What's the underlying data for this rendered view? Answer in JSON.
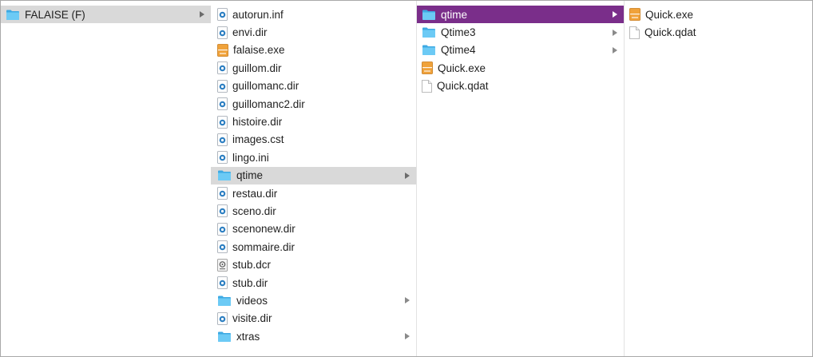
{
  "columns": [
    {
      "items": [
        {
          "label": "FALAISE (F)",
          "icon": "folder-icon",
          "chevron": true,
          "state": "gray"
        }
      ]
    },
    {
      "items": [
        {
          "label": "autorun.inf",
          "icon": "shockwave-file-icon",
          "chevron": false,
          "state": "none"
        },
        {
          "label": "envi.dir",
          "icon": "shockwave-file-icon",
          "chevron": false,
          "state": "none"
        },
        {
          "label": "falaise.exe",
          "icon": "exe-icon",
          "chevron": false,
          "state": "none"
        },
        {
          "label": "guillom.dir",
          "icon": "shockwave-file-icon",
          "chevron": false,
          "state": "none"
        },
        {
          "label": "guillomanc.dir",
          "icon": "shockwave-file-icon",
          "chevron": false,
          "state": "none"
        },
        {
          "label": "guillomanc2.dir",
          "icon": "shockwave-file-icon",
          "chevron": false,
          "state": "none"
        },
        {
          "label": "histoire.dir",
          "icon": "shockwave-file-icon",
          "chevron": false,
          "state": "none"
        },
        {
          "label": "images.cst",
          "icon": "shockwave-file-icon",
          "chevron": false,
          "state": "none"
        },
        {
          "label": "lingo.ini",
          "icon": "shockwave-file-icon",
          "chevron": false,
          "state": "none"
        },
        {
          "label": "qtime",
          "icon": "folder-icon",
          "chevron": true,
          "state": "gray"
        },
        {
          "label": "restau.dir",
          "icon": "shockwave-file-icon",
          "chevron": false,
          "state": "none"
        },
        {
          "label": "sceno.dir",
          "icon": "shockwave-file-icon",
          "chevron": false,
          "state": "none"
        },
        {
          "label": "scenonew.dir",
          "icon": "shockwave-file-icon",
          "chevron": false,
          "state": "none"
        },
        {
          "label": "sommaire.dir",
          "icon": "shockwave-file-icon",
          "chevron": false,
          "state": "none"
        },
        {
          "label": "stub.dcr",
          "icon": "dcr-file-icon",
          "chevron": false,
          "state": "none"
        },
        {
          "label": "stub.dir",
          "icon": "shockwave-file-icon",
          "chevron": false,
          "state": "none"
        },
        {
          "label": "videos",
          "icon": "folder-icon",
          "chevron": true,
          "state": "none"
        },
        {
          "label": "visite.dir",
          "icon": "shockwave-file-icon",
          "chevron": false,
          "state": "none"
        },
        {
          "label": "xtras",
          "icon": "folder-icon",
          "chevron": true,
          "state": "none"
        }
      ]
    },
    {
      "items": [
        {
          "label": "qtime",
          "icon": "folder-icon",
          "chevron": true,
          "state": "active"
        },
        {
          "label": "Qtime3",
          "icon": "folder-icon",
          "chevron": true,
          "state": "none"
        },
        {
          "label": "Qtime4",
          "icon": "folder-icon",
          "chevron": true,
          "state": "none"
        },
        {
          "label": "Quick.exe",
          "icon": "exe-icon",
          "chevron": false,
          "state": "none"
        },
        {
          "label": "Quick.qdat",
          "icon": "blank-document-icon",
          "chevron": false,
          "state": "none"
        }
      ]
    },
    {
      "items": [
        {
          "label": "Quick.exe",
          "icon": "exe-icon",
          "chevron": false,
          "state": "none"
        },
        {
          "label": "Quick.qdat",
          "icon": "blank-document-icon",
          "chevron": false,
          "state": "none"
        }
      ]
    }
  ],
  "colors": {
    "active_selection": "#7a2e8a",
    "inactive_selection": "#d9d9d9",
    "folder": "#5ec1f0",
    "exe": "#e8962e"
  }
}
